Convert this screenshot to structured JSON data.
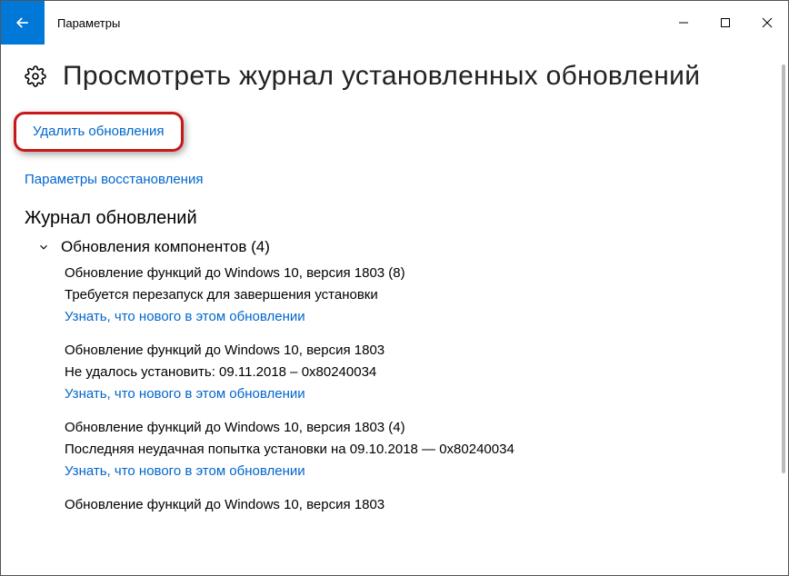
{
  "titlebar": {
    "title": "Параметры"
  },
  "page": {
    "heading": "Просмотреть журнал установленных обновлений"
  },
  "links": {
    "uninstall": "Удалить обновления",
    "recovery": "Параметры восстановления"
  },
  "history": {
    "heading": "Журнал обновлений",
    "group_label": "Обновления компонентов (4)",
    "items": [
      {
        "title": "Обновление функций до Windows 10, версия 1803 (8)",
        "status": "Требуется перезапуск для завершения установки",
        "link": "Узнать, что нового в этом обновлении"
      },
      {
        "title": "Обновление функций до Windows 10, версия 1803",
        "status": "Не удалось установить: 09.11.2018 – 0x80240034",
        "link": "Узнать, что нового в этом обновлении"
      },
      {
        "title": "Обновление функций до Windows 10, версия 1803 (4)",
        "status": "Последняя неудачная попытка установки на 09.10.2018 — 0x80240034",
        "link": "Узнать, что нового в этом обновлении"
      },
      {
        "title": "Обновление функций до Windows 10, версия 1803",
        "status": "",
        "link": ""
      }
    ]
  }
}
